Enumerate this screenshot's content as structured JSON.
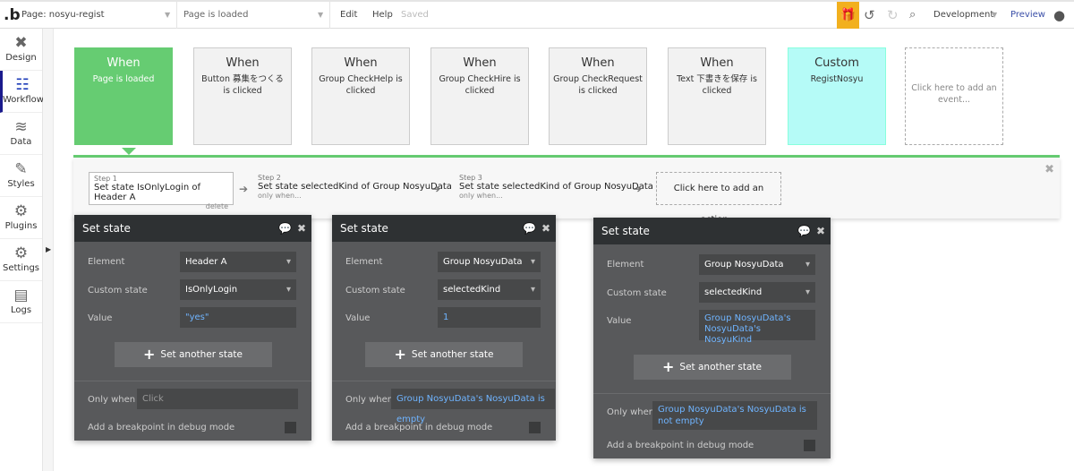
{
  "topbar": {
    "logo": ".b",
    "page": "Page: nosyu-regist",
    "event": "Page is loaded",
    "edit": "Edit",
    "help": "Help",
    "saved": "Saved",
    "env": "Development",
    "preview": "Preview"
  },
  "sidebar": {
    "items": [
      {
        "label": "Design",
        "icon": "✖"
      },
      {
        "label": "Workflow",
        "icon": "☷"
      },
      {
        "label": "Data",
        "icon": "≋"
      },
      {
        "label": "Styles",
        "icon": "✎"
      },
      {
        "label": "Plugins",
        "icon": "⚙"
      },
      {
        "label": "Settings",
        "icon": "⚙"
      },
      {
        "label": "Logs",
        "icon": "▤"
      }
    ]
  },
  "events": [
    {
      "head": "When",
      "sub": "Page is loaded"
    },
    {
      "head": "When",
      "sub": "Button 募集をつくる is clicked"
    },
    {
      "head": "When",
      "sub": "Group CheckHelp is clicked"
    },
    {
      "head": "When",
      "sub": "Group CheckHire is clicked"
    },
    {
      "head": "When",
      "sub": "Group CheckRequest is clicked"
    },
    {
      "head": "When",
      "sub": "Text 下書きを保存 is clicked"
    },
    {
      "head": "Custom",
      "sub": "RegistNosyu"
    },
    {
      "head": "",
      "sub": "Click here to add an event..."
    }
  ],
  "steps": [
    {
      "num": "Step 1",
      "label": "Set state IsOnlyLogin of Header A",
      "extra": "delete"
    },
    {
      "num": "Step 2",
      "label": "Set state selectedKind of Group NosyuData",
      "extra": "only when..."
    },
    {
      "num": "Step 3",
      "label": "Set state selectedKind of Group NosyuData",
      "extra": "only when..."
    }
  ],
  "add_action": "Click here to add an action...",
  "labels": {
    "element": "Element",
    "custom_state": "Custom state",
    "value": "Value",
    "only_when": "Only when",
    "breakpoint": "Add a breakpoint in debug mode",
    "another": "Set another state"
  },
  "panels": [
    {
      "title": "Set state",
      "element": "Header A",
      "state": "IsOnlyLogin",
      "value": "\"yes\"",
      "only_when": "Click"
    },
    {
      "title": "Set state",
      "element": "Group NosyuData",
      "state": "selectedKind",
      "value": "1",
      "only_when": "Group NosyuData's NosyuData is empty"
    },
    {
      "title": "Set state",
      "element": "Group NosyuData",
      "state": "selectedKind",
      "value": "Group NosyuData's NosyuData's NosyuKind",
      "only_when": "Group NosyuData's NosyuData is not empty"
    }
  ]
}
